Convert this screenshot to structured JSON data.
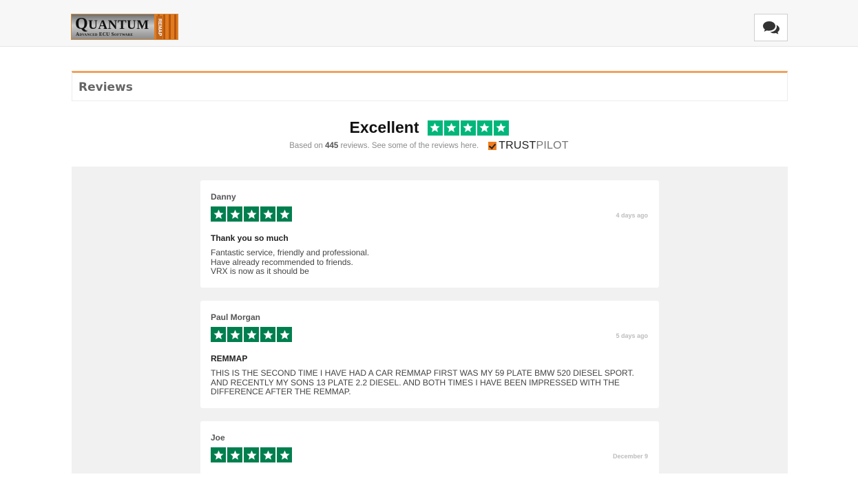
{
  "header": {
    "logo": {
      "word": "Quantum",
      "sub": "Advanced ECU Software",
      "side": "REMAP"
    },
    "chat_icon": "comments-icon"
  },
  "section": {
    "title": "Reviews"
  },
  "summary": {
    "label": "Excellent",
    "rating_stars": 5,
    "note_prefix": "Based on",
    "review_count": "445",
    "note_suffix": "reviews. See some of the reviews here.",
    "brand_dark": "TRUST",
    "brand_light": "PILOT"
  },
  "reviews": [
    {
      "author": "Danny",
      "stars": 5,
      "date": "4 days ago",
      "headline": "Thank you so much",
      "body": [
        "Fantastic service, friendly and professional.",
        "Have already recommended to friends.",
        "VRX is now as it should be"
      ]
    },
    {
      "author": "Paul Morgan",
      "stars": 5,
      "date": "5 days ago",
      "headline": "REMMAP",
      "body": [
        "THIS IS THE SECOND TIME I HAVE HAD A CAR REMMAP FIRST WAS MY 59 PLATE BMW 520 DIESEL SPORT. AND RECENTLY MY SONS 13 PLATE 2.2 DIESEL. AND BOTH TIMES I HAVE BEEN IMPRESSED WITH THE DIFFERENCE AFTER THE REMMAP."
      ]
    },
    {
      "author": "Joe",
      "stars": 5,
      "date": "December 9"
    }
  ],
  "colors": {
    "star_green": "#00b67a",
    "accent_orange": "#f0a25e"
  }
}
